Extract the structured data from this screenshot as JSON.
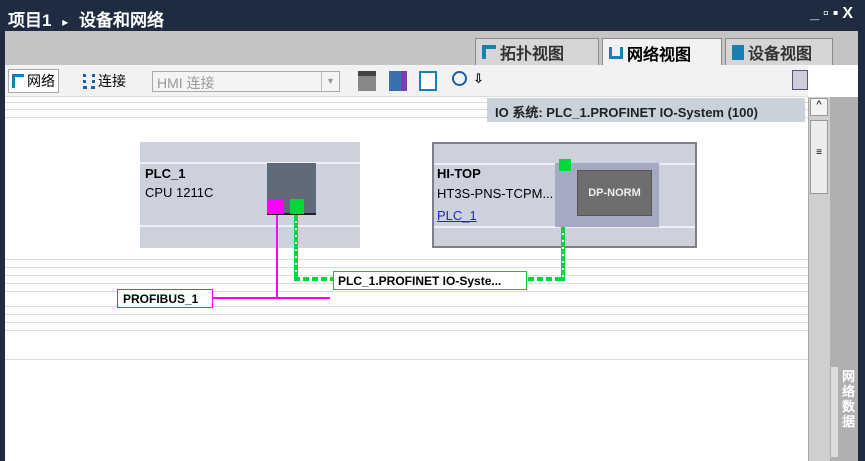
{
  "title": {
    "project": "项目1",
    "arrow": "▸",
    "section": "设备和网络"
  },
  "window_buttons": [
    "_",
    "▫",
    "▪",
    "X"
  ],
  "tabs": [
    {
      "label": "拓扑视图",
      "icon": "topology-icon"
    },
    {
      "label": "网络视图",
      "icon": "network-icon",
      "active": true
    },
    {
      "label": "设备视图",
      "icon": "device-icon"
    }
  ],
  "toolbar": {
    "network": "网络",
    "connections": "连接",
    "connection_type": "HMI 连接"
  },
  "io_system": {
    "pin": "𝟙",
    "label": "IO 系统: PLC_1.PROFINET IO-System (100)"
  },
  "devices": [
    {
      "name": "PLC_1",
      "type": "CPU 1211C"
    },
    {
      "name": "HI-TOP",
      "type": "HT3S-PNS-TCPM...",
      "controller": "PLC_1",
      "module": "DP-NORM"
    }
  ],
  "networks": {
    "profibus": "PROFIBUS_1",
    "profinet": "PLC_1.PROFINET IO-Syste..."
  },
  "side_panel": {
    "label": "网络数据"
  },
  "colors": {
    "profibus": "#ff00ff",
    "profinet": "#00cc33",
    "titlebar": "#1f2b40"
  }
}
